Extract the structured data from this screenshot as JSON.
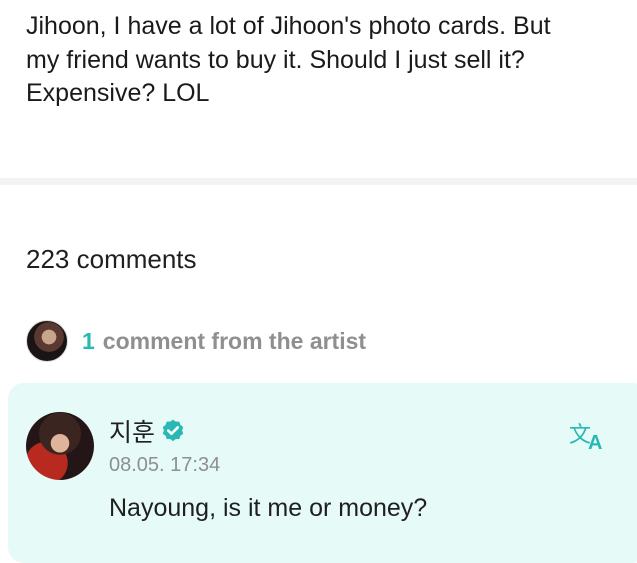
{
  "post": {
    "lines": [
      "Jihoon, I have a lot of Jihoon's photo cards. But",
      "my friend wants to buy it. Should I just sell it?",
      "Expensive? LOL"
    ]
  },
  "comments": {
    "count_label": "223 comments"
  },
  "artist_comments": {
    "count": "1",
    "label": "comment from the artist"
  },
  "comment": {
    "author": "지훈",
    "timestamp": "08.05. 17:34",
    "text": "Nayoung, is it me or money?"
  },
  "icons": {
    "verified": "verified-badge-icon",
    "translate": "translate-icon"
  },
  "colors": {
    "accent": "#28b9b4",
    "card_background": "#e6faf7",
    "muted_text": "#8f8f8f"
  }
}
